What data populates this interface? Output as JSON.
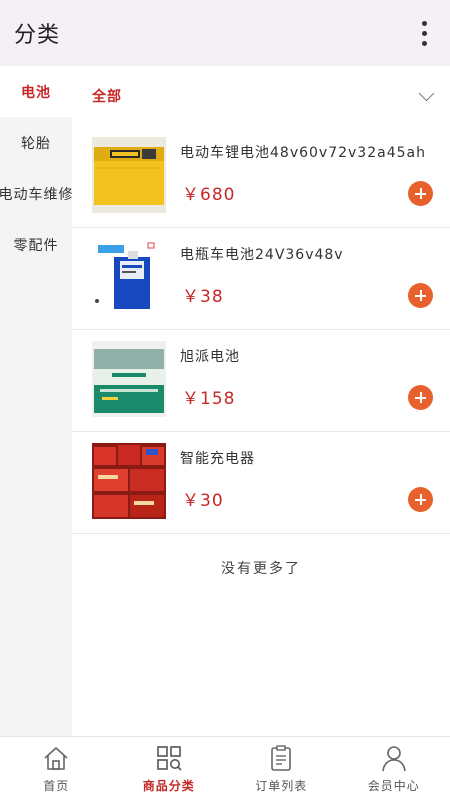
{
  "header": {
    "title": "分类"
  },
  "sidebar": {
    "items": [
      {
        "label": "电池"
      },
      {
        "label": "轮胎"
      },
      {
        "label": "电动车维修"
      },
      {
        "label": "零配件"
      }
    ]
  },
  "filter": {
    "label": "全部"
  },
  "products": [
    {
      "name": "电动车锂电池48v60v72v32a45ah",
      "price": "￥680"
    },
    {
      "name": "电瓶车电池24V36v48v",
      "price": "￥38"
    },
    {
      "name": "旭派电池",
      "price": "￥158"
    },
    {
      "name": "智能充电器",
      "price": "￥30"
    }
  ],
  "end_note": "没有更多了",
  "tabbar": {
    "items": [
      {
        "label": "首页"
      },
      {
        "label": "商品分类"
      },
      {
        "label": "订单列表"
      },
      {
        "label": "会员中心"
      }
    ]
  },
  "colors": {
    "accent": "#c62828",
    "add_button": "#e8612c",
    "appbar": "#f5eff6",
    "sidebar": "#f4f4f4"
  }
}
